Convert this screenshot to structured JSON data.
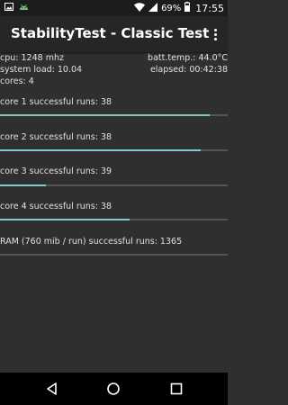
{
  "status_bar": {
    "left_icons": [
      "image-icon",
      "android-icon"
    ],
    "right_icons": [
      "wifi-icon",
      "signal-icon",
      "battery-icon"
    ],
    "battery_percent": "69%",
    "time": "17:55"
  },
  "app_bar": {
    "title": "StabilityTest - Classic Test",
    "overflow_icon": "more-vert-icon"
  },
  "info": {
    "cpu": "cpu: 1248 mhz",
    "batt_temp": "batt.temp.: 44.0°C",
    "system_load": "system load: 10.04",
    "elapsed": "elapsed: 00:42:38",
    "cores": "cores: 4"
  },
  "cores": [
    {
      "label": "core 1 successful runs: 38",
      "progress": 0.92
    },
    {
      "label": "core 2 successful runs: 38",
      "progress": 0.88
    },
    {
      "label": "core 3 successful runs: 39",
      "progress": 0.2
    },
    {
      "label": "core 4 successful runs: 38",
      "progress": 0.57
    }
  ],
  "ram": {
    "label": "RAM (760 mib / run) successful runs: 1365",
    "progress": 0.0
  },
  "nav_bar": {
    "icons": [
      "back-icon",
      "home-icon",
      "recents-icon"
    ]
  },
  "colors": {
    "accent": "#7ecbc7",
    "track": "#555555",
    "background": "#2f2f2f"
  }
}
